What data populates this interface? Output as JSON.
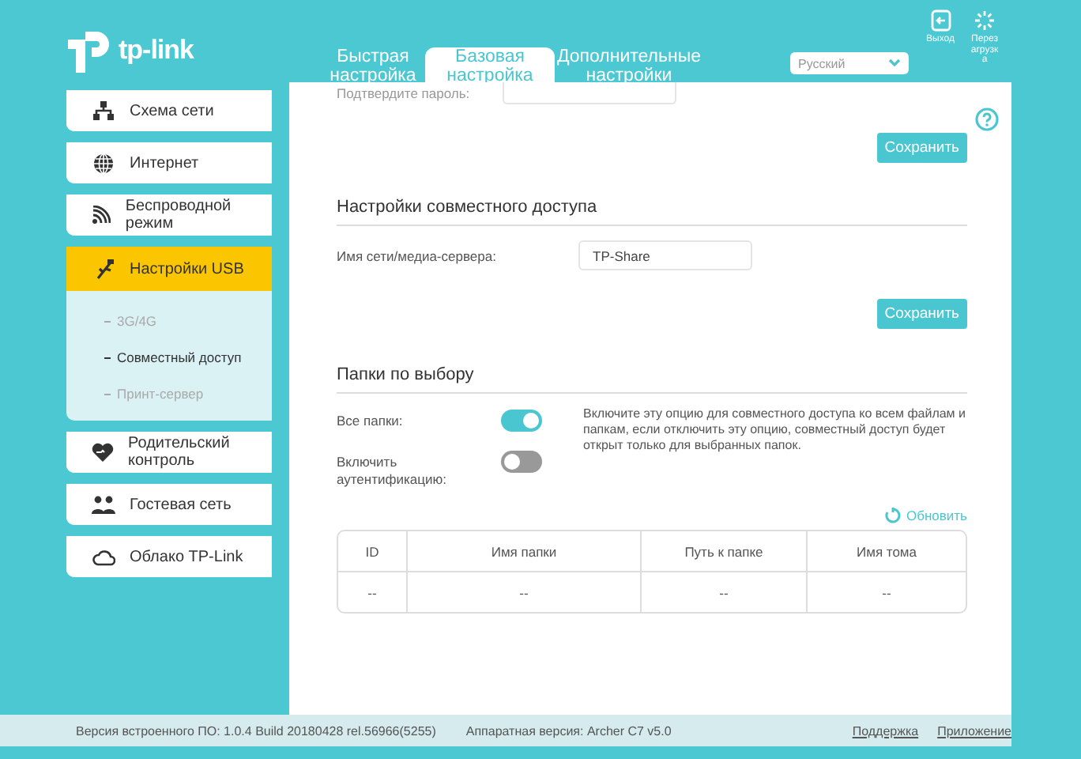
{
  "logo": {
    "text": "tp-link"
  },
  "tabs": [
    {
      "label": "Быстрая настройка",
      "selected": false
    },
    {
      "label": "Базовая настройка",
      "selected": true
    },
    {
      "label": "Дополнительные настройки",
      "selected": false
    }
  ],
  "language": {
    "value": "Русский"
  },
  "header_actions": [
    {
      "label": "Выход",
      "kind": "logout"
    },
    {
      "label": "Перезагрузка",
      "kind": "reboot"
    }
  ],
  "sidebar": {
    "items": [
      {
        "label": "Схема сети",
        "kind": "network",
        "selected": false
      },
      {
        "label": "Интернет",
        "kind": "globe",
        "selected": false
      },
      {
        "label": "Беспроводной режим",
        "kind": "wireless",
        "selected": false
      },
      {
        "label": "Настройки USB",
        "kind": "usb",
        "selected": true,
        "children": [
          {
            "label": "3G/4G",
            "selected": false
          },
          {
            "label": "Совместный доступ",
            "selected": true
          },
          {
            "label": "Принт-сервер",
            "selected": false
          }
        ]
      },
      {
        "label": "Родительский контроль",
        "kind": "heart",
        "selected": false
      },
      {
        "label": "Гостевая сеть",
        "kind": "guests",
        "selected": false
      },
      {
        "label": "Облако TP-Link",
        "kind": "cloud",
        "selected": false
      }
    ]
  },
  "password_section": {
    "label": "Подтвердите пароль:",
    "save": "Сохранить"
  },
  "sharing_section": {
    "title": "Настройки совместного доступа",
    "name_label": "Имя сети/медиа-сервера:",
    "name_value": "TP-Share",
    "save": "Сохранить"
  },
  "folders_section": {
    "title": "Папки по выбору",
    "toggles": [
      {
        "label": "Все папки:",
        "on": true
      },
      {
        "label": "Включить аутентификацию:",
        "on": false
      }
    ],
    "description": "Включите эту опцию для совместного доступа ко всем файлам и папкам, если отключить эту опцию, совместный доступ будет открыт только для выбранных папок.",
    "refresh": "Обновить",
    "table": {
      "columns": [
        "ID",
        "Имя папки",
        "Путь к папке",
        "Имя тома"
      ],
      "rows": [
        [
          "--",
          "--",
          "--",
          "--"
        ]
      ]
    }
  },
  "status_bar": {
    "firmware": "Версия встроенного ПО: 1.0.4 Build 20180428 rel.56966(5255)",
    "hardware": "Аппаратная версия: Archer C7 v5.0",
    "links": [
      "Поддержка",
      "Приложение"
    ]
  }
}
